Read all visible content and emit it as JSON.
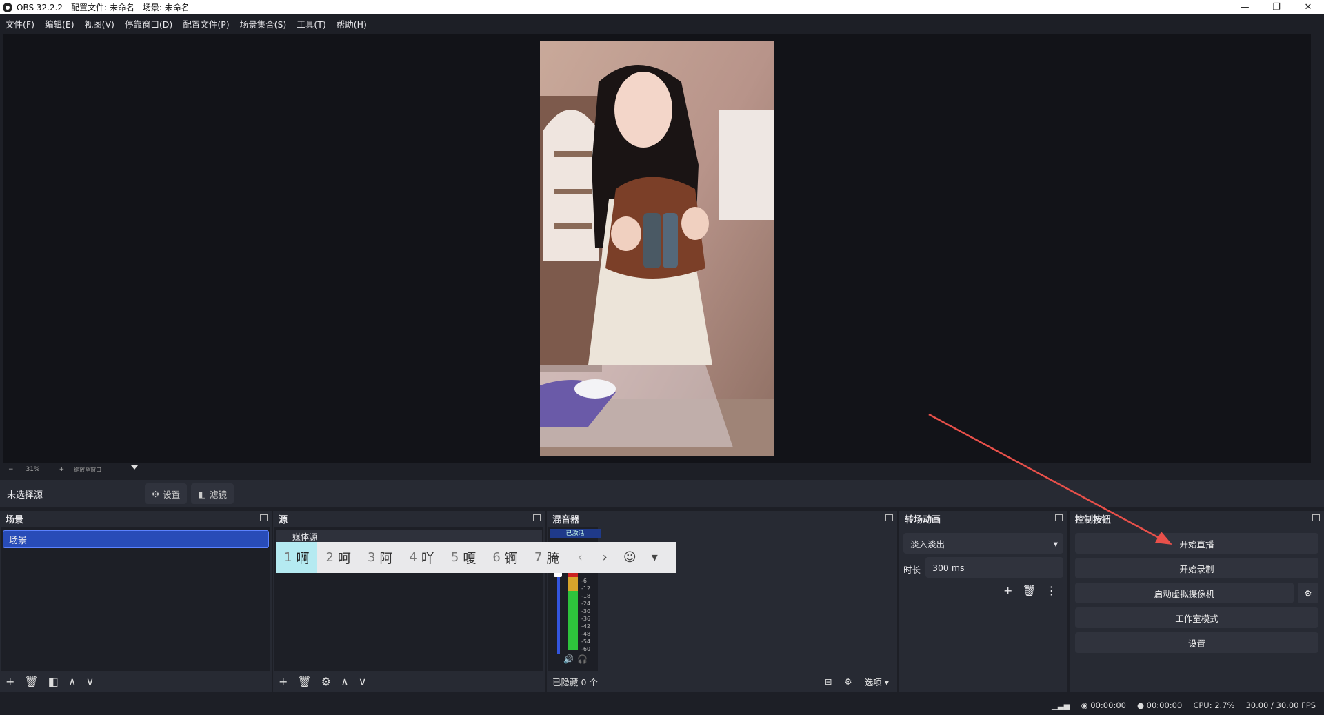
{
  "titlebar": {
    "title": "OBS 32.2.2 - 配置文件: 未命名 - 场景: 未命名",
    "minimize": "—",
    "restore": "❐",
    "close": "✕"
  },
  "menu": [
    "文件(F)",
    "编辑(E)",
    "视图(V)",
    "停靠窗口(D)",
    "配置文件(P)",
    "场景集合(S)",
    "工具(T)",
    "帮助(H)"
  ],
  "zoom": {
    "minus": "−",
    "value": "31%",
    "plus": "+",
    "label": "缩放至窗口"
  },
  "source_bar": {
    "no_source": "未选择源",
    "settings": "设置",
    "filters": "滤镜"
  },
  "docks": {
    "scenes": {
      "title": "场景",
      "items": [
        "场景"
      ]
    },
    "sources": {
      "title": "源",
      "items": [
        "媒体源"
      ]
    },
    "mixer": {
      "title": "混音器",
      "channel": "已激活",
      "hidden": "已隐藏 0 个",
      "options": "选项",
      "scale": [
        "-6",
        "-12",
        "-18",
        "-24",
        "-30",
        "-36",
        "-42",
        "-48",
        "-54",
        "-60"
      ]
    },
    "transitions": {
      "title": "转场动画",
      "selected": "淡入淡出",
      "duration_label": "时长",
      "duration": "300 ms"
    },
    "controls": {
      "title": "控制按钮",
      "start_stream": "开始直播",
      "start_record": "开始录制",
      "virtual_cam": "启动虚拟摄像机",
      "studio_mode": "工作室模式",
      "settings": "设置"
    }
  },
  "ime": {
    "candidates": [
      {
        "n": "1",
        "c": "啊"
      },
      {
        "n": "2",
        "c": "呵"
      },
      {
        "n": "3",
        "c": "阿"
      },
      {
        "n": "4",
        "c": "吖"
      },
      {
        "n": "5",
        "c": "嗄"
      },
      {
        "n": "6",
        "c": "锕"
      },
      {
        "n": "7",
        "c": "腌"
      }
    ],
    "prev": "‹",
    "next": "›",
    "emoji": "☺"
  },
  "status": {
    "rec_time1": "00:00:00",
    "rec_time2": "00:00:00",
    "cpu": "CPU: 2.7%",
    "fps": "30.00 / 30.00 FPS"
  },
  "colors": {
    "panel": "#272a33",
    "background": "#1d1f26",
    "accent": "#284cb8",
    "arrow": "#e8504a"
  }
}
